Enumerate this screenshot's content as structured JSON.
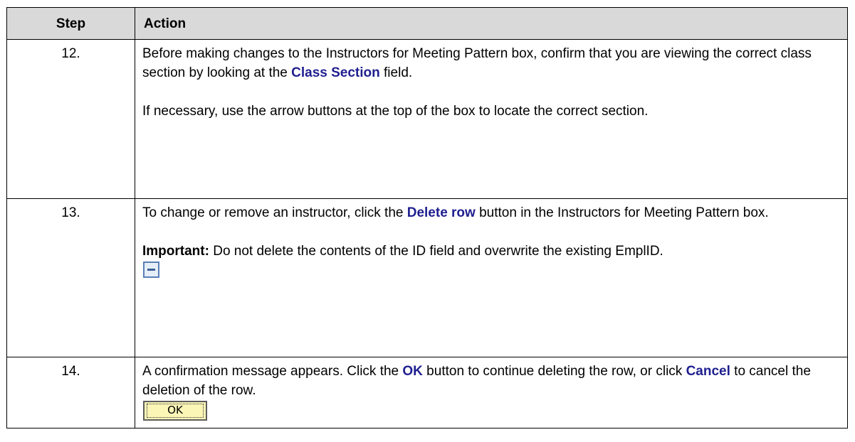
{
  "table": {
    "headers": {
      "step": "Step",
      "action": "Action"
    },
    "rows": [
      {
        "step": "12.",
        "p1_a": "Before making changes to the Instructors for Meeting Pattern box, confirm that you are viewing the correct class section by looking at the ",
        "p1_hl": "Class Section",
        "p1_b": " field.",
        "p2": "If necessary, use the arrow buttons at the top of the box to locate the correct section."
      },
      {
        "step": "13.",
        "p1_a": "To change or remove an instructor, click the ",
        "p1_hl": "Delete row",
        "p1_b": " button in the Instructors for Meeting Pattern box.",
        "p2_bold": "Important:",
        "p2_rest": " Do not delete the contents of the ID field and overwrite the existing EmplID.",
        "icon": "delete-row-icon"
      },
      {
        "step": "14.",
        "p1_a": "A confirmation message appears.  Click the ",
        "p1_hl": "OK",
        "p1_b": " button to continue deleting the row, or click ",
        "p1_hl2": "Cancel",
        "p1_c": " to cancel the deletion of the row.",
        "button_label": "OK"
      }
    ]
  },
  "colors": {
    "header_bg": "#d9d9d9",
    "highlight_text": "#1f1f8f",
    "ok_button_bg": "#fbf5b6"
  }
}
